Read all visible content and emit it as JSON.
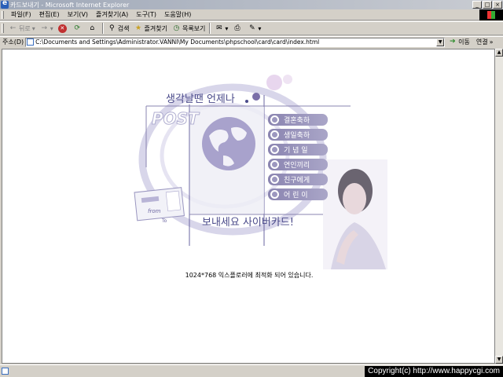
{
  "window": {
    "title": "카드보내기 - Microsoft Internet Explorer",
    "controls": [
      "_",
      "□",
      "×"
    ]
  },
  "menu": [
    "파일(F)",
    "편집(E)",
    "보기(V)",
    "즐겨찾기(A)",
    "도구(T)",
    "도움말(H)"
  ],
  "toolbar": {
    "back": "뒤로",
    "search": "검색",
    "favorites": "즐겨찾기",
    "history": "목록보기"
  },
  "address": {
    "label": "주소(D)",
    "url": "C:\\Documents and Settings\\Administrator.VANNI\\My Documents\\phpschool\\card\\card\\index.html",
    "go": "이동",
    "links": "연결"
  },
  "card": {
    "headline": "생각날땐 언제나",
    "post_word": "POST",
    "tagline": "보내세요 사이버카드!",
    "envelope_text": "from",
    "envelope_to": "To",
    "categories": [
      "결혼축하",
      "생일축하",
      "기 념 일",
      "연인끼리",
      "친구에게",
      "어 린 이"
    ]
  },
  "notice": "1024*768 익스플로러에 최적화 되어 있습니다.",
  "copyright": "Copyright(c) http://www.happycgi.com",
  "colors": {
    "accent": "#8a84b0",
    "headline": "#4a4a8a",
    "chrome": "#d4d0c8"
  }
}
